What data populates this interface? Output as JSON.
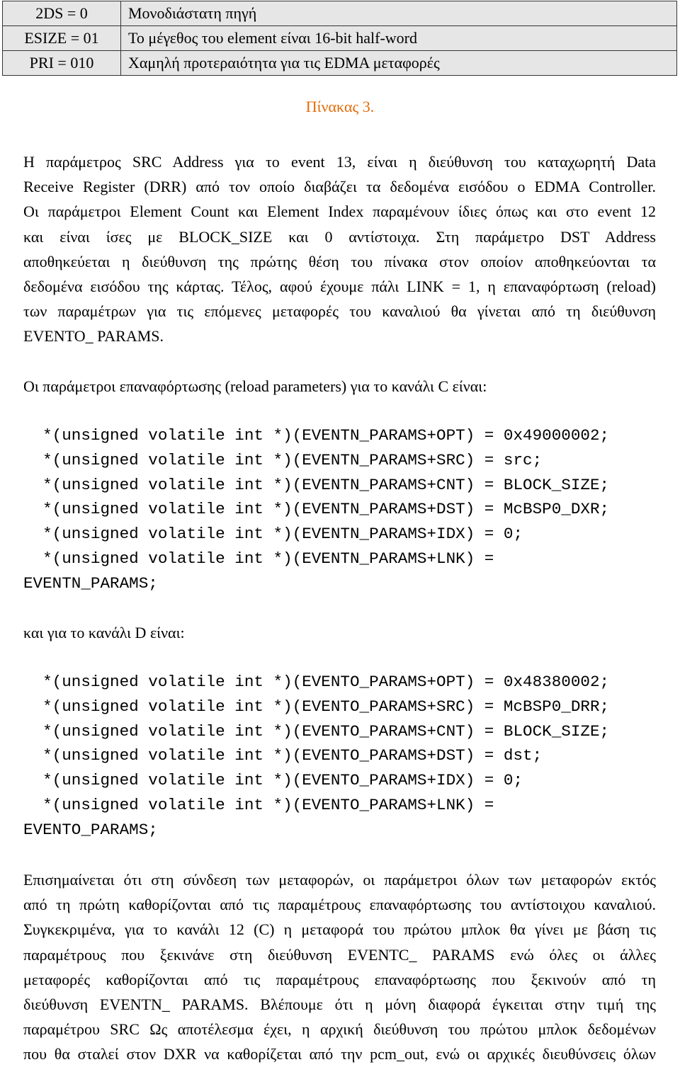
{
  "table": [
    [
      "2DS = 0",
      "Μονοδιάστατη πηγή"
    ],
    [
      "ESIZE = 01",
      "Το μέγεθος του element είναι 16-bit half-word"
    ],
    [
      "PRI = 010",
      "Χαμηλή προτεραιότητα για τις EDMA μεταφορές"
    ]
  ],
  "caption": "Πίνακας 3.",
  "para1": [
    "Η παράμετρος SRC Address για το event 13, είναι η διεύθυνση του καταχωρητή Data",
    "Receive Register (DRR) από τον οποίο διαβάζει τα δεδομένα εισόδου ο EDMA Controller.",
    "Οι παράμετροι Element Count και Element Index παραμένουν ίδιες όπως και στο event 12",
    "και είναι ίσες με BLOCK_SIZE και 0 αντίστοιχα. Στη παράμετρο DST Address",
    "αποθηκεύεται η διεύθυνση της πρώτης θέση του πίνακα στον οποίον αποθηκεύονται τα",
    "δεδομένα εισόδου της κάρτας. Τέλος, αφού έχουμε πάλι LINK = 1, η επαναφόρτωση (reload)",
    "των παραμέτρων για τις επόμενες μεταφορές του καναλιού θα γίνεται από τη διεύθυνση",
    "EVENTO_ PARAMS."
  ],
  "para2": "Οι παράμετροι επαναφόρτωσης (reload parameters) για το κανάλι C είναι:",
  "codeC": [
    "  *(unsigned volatile int *)(EVENTN_PARAMS+OPT) = 0x49000002;",
    "  *(unsigned volatile int *)(EVENTN_PARAMS+SRC) = src;",
    "  *(unsigned volatile int *)(EVENTN_PARAMS+CNT) = BLOCK_SIZE;",
    "  *(unsigned volatile int *)(EVENTN_PARAMS+DST) = McBSP0_DXR;",
    "  *(unsigned volatile int *)(EVENTN_PARAMS+IDX) = 0;",
    "  *(unsigned volatile int *)(EVENTN_PARAMS+LNK) =",
    "EVENTN_PARAMS;"
  ],
  "para3": "και για το κανάλι D είναι:",
  "codeD": [
    "  *(unsigned volatile int *)(EVENTO_PARAMS+OPT) = 0x48380002;",
    "  *(unsigned volatile int *)(EVENTO_PARAMS+SRC) = McBSP0_DRR;",
    "  *(unsigned volatile int *)(EVENTO_PARAMS+CNT) = BLOCK_SIZE;",
    "  *(unsigned volatile int *)(EVENTO_PARAMS+DST) = dst;",
    "  *(unsigned volatile int *)(EVENTO_PARAMS+IDX) = 0;",
    "  *(unsigned volatile int *)(EVENTO_PARAMS+LNK) =",
    "EVENTO_PARAMS;"
  ],
  "para4": [
    "Επισημαίνεται ότι στη σύνδεση των μεταφορών, οι παράμετροι όλων των μεταφορών εκτός",
    "από τη πρώτη καθορίζονται από τις παραμέτρους επαναφόρτωσης του αντίστοιχου καναλιού.",
    "Συγκεκριμένα, για το κανάλι 12 (C) η μεταφορά του πρώτου μπλοκ θα γίνει με βάση τις",
    "παραμέτρους που ξεκινάνε στη διεύθυνση EVENTC_ PARAMS ενώ όλες οι άλλες",
    "μεταφορές καθορίζονται από τις παραμέτρους επαναφόρτωσης που ξεκινούν από τη",
    "διεύθυνση EVENTN_ PARAMS. Βλέπουμε ότι η μόνη διαφορά έγκειται στην τιμή της",
    "παραμέτρου SRC Ως αποτέλεσμα έχει, η αρχική διεύθυνση του πρώτου μπλοκ δεδομένων",
    "που θα σταλεί στον DXR να καθορίζεται από την pcm_out, ενώ οι αρχικές διευθύνσεις όλων"
  ]
}
